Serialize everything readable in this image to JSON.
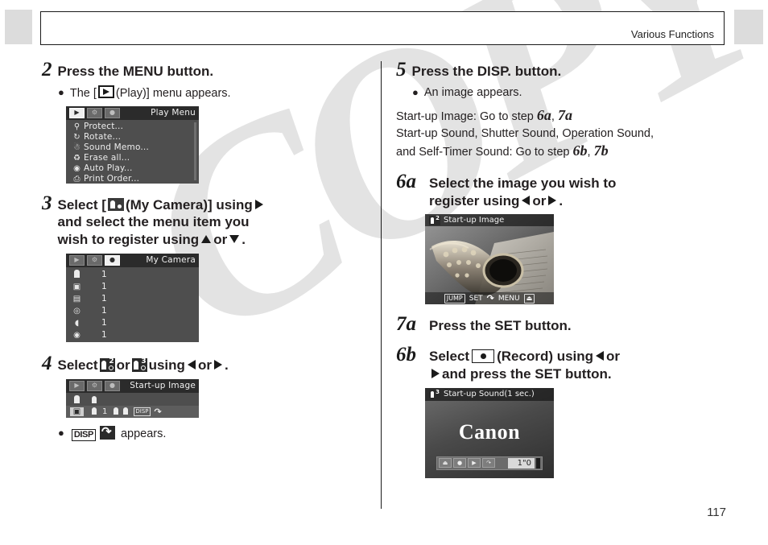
{
  "header": {
    "title": "Various Functions"
  },
  "page_number": "117",
  "watermark": "COPY",
  "left_column": {
    "step2": {
      "number": "2",
      "text": "Press the MENU button.",
      "bullet_pre": "The [",
      "bullet_icon": "play-mode-icon",
      "bullet_post": "(Play)] menu appears.",
      "lcd": {
        "title": "Play Menu",
        "tabs": [
          "play-tab",
          "setup-tab",
          "my-camera-tab"
        ],
        "active_tab_index": 0,
        "rows": [
          {
            "icon": "key-icon",
            "label": "Protect..."
          },
          {
            "icon": "rotate-icon",
            "label": "Rotate..."
          },
          {
            "icon": "microphone-icon",
            "label": "Sound Memo..."
          },
          {
            "icon": "trash-icon",
            "label": "Erase all..."
          },
          {
            "icon": "auto-play-icon",
            "label": "Auto Play..."
          },
          {
            "icon": "printer-icon",
            "label": "Print Order..."
          }
        ]
      }
    },
    "step3": {
      "number": "3",
      "line1_pre": "Select [",
      "line1_icon": "my-camera-icon",
      "line1_post": "(My Camera)] using",
      "line2": "and select the menu item you",
      "line3_pre": "wish to register using",
      "line3_mid": "or",
      "line3_post": ".",
      "lcd": {
        "title": "My Camera",
        "tabs": [
          "play-tab",
          "setup-tab",
          "my-camera-tab"
        ],
        "active_tab_index": 2,
        "rows": [
          {
            "icon": "theme-icon",
            "value": "1"
          },
          {
            "icon": "start-up-image-icon",
            "value": "1"
          },
          {
            "icon": "start-up-sound-icon",
            "value": "1"
          },
          {
            "icon": "operation-sound-icon",
            "value": "1"
          },
          {
            "icon": "self-timer-sound-icon",
            "value": "1"
          },
          {
            "icon": "shutter-sound-icon",
            "value": "1"
          }
        ]
      }
    },
    "step4": {
      "number": "4",
      "pre": "Select",
      "icon_a": "my-camera-set-2-icon",
      "mid": "or",
      "icon_b": "my-camera-set-3-icon",
      "using": "using",
      "or": "or",
      "end": ".",
      "lcd": {
        "title": "Start-up Image",
        "tabs": [
          "play-tab",
          "setup-tab",
          "my-camera-tab"
        ],
        "active_tab_index": 2,
        "row1_icon": "theme-icon",
        "row1_value_icon": "set-2-icon",
        "row2_icon": "start-up-image-icon",
        "row2_value_icon": "set-2-icon",
        "row2_value": "1",
        "row2_chip_a": "set-2-icon",
        "row2_chip_b": "set-3-icon",
        "row2_disp": "DISP",
        "row2_rec": "record-arrow-icon"
      },
      "bullet_disp": "DISP",
      "bullet_rec": "record-arrow-icon",
      "bullet_text": "appears."
    }
  },
  "right_column": {
    "step5": {
      "number": "5",
      "text": "Press the DISP. button.",
      "bullet": "An image appears.",
      "para1_pre": "Start-up Image: Go to step ",
      "para1_step_a": "6a",
      "para1_sep": ", ",
      "para1_step_b": "7a",
      "para2_line1": "Start-up Sound, Shutter Sound, Operation Sound,",
      "para2_line2_pre": "and Self-Timer Sound: Go to step ",
      "para2_step_a": "6b",
      "para2_sep": ", ",
      "para2_step_b": "7b"
    },
    "step6a": {
      "number": "6a",
      "line1": "Select the image you wish to",
      "line2_pre": "register using",
      "line2_mid": "or",
      "line2_post": ".",
      "lcd": {
        "title": "Start-up Image",
        "title_icon": "my-camera-set-2-icon",
        "image_subject": "saxophone-photo",
        "foot_items": [
          "JUMP",
          "SET",
          "record-arrow-icon",
          "MENU",
          "exit-icon"
        ]
      }
    },
    "step7a": {
      "number": "7a",
      "text": "Press the SET button."
    },
    "step6b": {
      "number": "6b",
      "pre": "Select",
      "icon": "record-button-icon",
      "post": "(Record) using",
      "or": "or",
      "line2": "and press the SET button.",
      "lcd": {
        "title": "Start-up Sound(1 sec.)",
        "title_icon": "my-camera-set-3-icon",
        "logo": "Canon",
        "bar_buttons": [
          "exit-icon",
          "record-icon",
          "play-icon",
          "record-arrow-icon"
        ],
        "time": "1\"0"
      }
    }
  }
}
